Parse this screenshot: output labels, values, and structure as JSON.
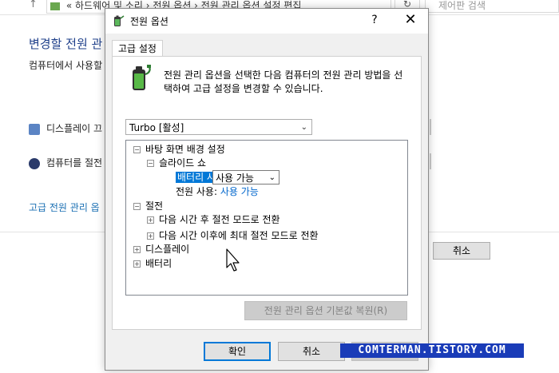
{
  "background": {
    "nav_arrow": "↑",
    "address_text": "« 하드웨어 및 소리 › 전원 옵션 › 전원 관리 옵션 설정 편집",
    "search_placeholder": "제어판 검색",
    "heading": "변경할 전원 관",
    "subheading": "컴퓨터에서 사용할",
    "item_display": "디스플레이 끄",
    "item_sleep": "컴퓨터를 절전",
    "link_advanced": "고급 전원 관리 옵",
    "cancel_label": "취소"
  },
  "dialog": {
    "title": "전원 옵션",
    "help_label": "?",
    "close_label": "✕",
    "tab_label": "고급 설정",
    "description": "전원 관리 옵션을 선택한 다음 컴퓨터의 전원 관리 방법을 선택하여 고급 설정을 변경할 수 있습니다.",
    "plan_selected": "Turbo [활성]",
    "tree": {
      "desktop_bg": "바탕 화면 배경 설정",
      "slideshow": "슬라이드 쇼",
      "battery_label": "배터리 사용:",
      "battery_value": "사용 가능",
      "ac_label": "전원 사용:",
      "ac_value": "사용 가능",
      "sleep": "절전",
      "sleep_after": "다음 시간 후 절전 모드로 전환",
      "hibernate_after": "다음 시간 이후에 최대 절전 모드로 전환",
      "display": "디스플레이",
      "battery": "배터리"
    },
    "restore_label": "전원 관리 옵션 기본값 복원(R)",
    "ok_label": "확인",
    "cancel_label": "취소",
    "apply_label": "적용"
  },
  "watermark": "COMTERMAN.TISTORY.COM",
  "colors": {
    "selection": "#0078d7",
    "link": "#0066cc",
    "watermark_bg": "#1a3cb8",
    "heading": "#1e3f8a"
  },
  "icons": {
    "title_icon": "battery-plug-icon",
    "description_icon": "battery-plug-icon",
    "collapse": "minus-box-icon",
    "expand": "plus-box-icon"
  }
}
